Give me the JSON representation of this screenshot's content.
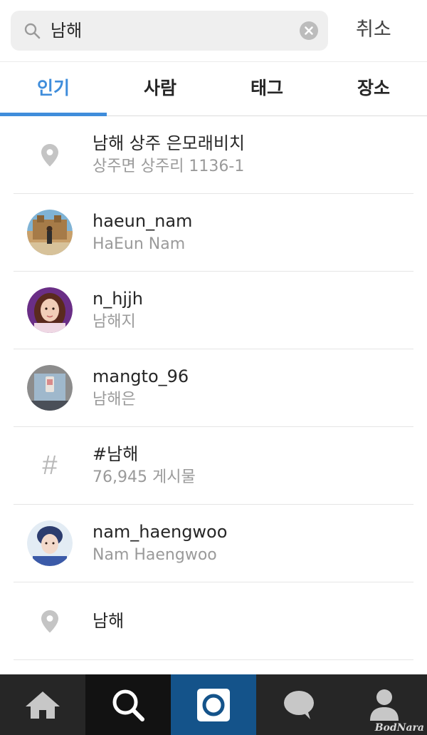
{
  "search": {
    "query": "남해",
    "cancel_label": "취소",
    "icons": {
      "search": "search-icon",
      "clear": "clear-icon"
    }
  },
  "tabs": [
    {
      "label": "인기",
      "active": true
    },
    {
      "label": "사람",
      "active": false
    },
    {
      "label": "태그",
      "active": false
    },
    {
      "label": "장소",
      "active": false
    }
  ],
  "results": [
    {
      "type": "place",
      "icon": "location-pin-icon",
      "title": "남해 상주 은모래비치",
      "subtitle": "상주면 상주리 1136-1"
    },
    {
      "type": "user",
      "icon": "avatar",
      "title": "haeun_nam",
      "subtitle": "HaEun Nam"
    },
    {
      "type": "user",
      "icon": "avatar",
      "title": "n_hjjh",
      "subtitle": "남해지"
    },
    {
      "type": "user",
      "icon": "avatar",
      "title": "mangto_96",
      "subtitle": "남해은"
    },
    {
      "type": "hashtag",
      "icon": "hashtag-icon",
      "symbol": "#",
      "title": "#남해",
      "subtitle": "76,945 게시물"
    },
    {
      "type": "user",
      "icon": "avatar",
      "title": "nam_haengwoo",
      "subtitle": "Nam Haengwoo"
    },
    {
      "type": "place",
      "icon": "location-pin-icon",
      "title": "남해",
      "subtitle": ""
    }
  ],
  "bottom_nav": [
    {
      "icon": "home-icon",
      "selected": false
    },
    {
      "icon": "search-icon",
      "selected": true
    },
    {
      "icon": "camera-icon",
      "selected": false
    },
    {
      "icon": "activity-bubble-icon",
      "selected": false
    },
    {
      "icon": "profile-icon",
      "selected": false
    }
  ],
  "watermark": "BodNara",
  "colors": {
    "accent": "#3f8ddb",
    "nav_background": "#262626",
    "camera_button": "#14538a",
    "secondary_text": "#9a9a9a"
  }
}
